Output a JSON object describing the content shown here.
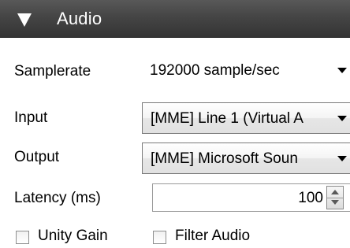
{
  "header": {
    "title": "Audio",
    "icon": "collapse-triangle-icon"
  },
  "fields": {
    "samplerate": {
      "label": "Samplerate",
      "value": "192000 sample/sec"
    },
    "input": {
      "label": "Input",
      "value": "[MME] Line 1 (Virtual A"
    },
    "output": {
      "label": "Output",
      "value": "[MME] Microsoft Soun"
    },
    "latency": {
      "label": "Latency (ms)",
      "value": "100"
    }
  },
  "checkboxes": {
    "unity_gain": {
      "label": "Unity Gain",
      "checked": false
    },
    "filter_audio": {
      "label": "Filter Audio",
      "checked": false
    }
  },
  "colors": {
    "header_bg": "#454545",
    "header_text": "#ffffff"
  }
}
